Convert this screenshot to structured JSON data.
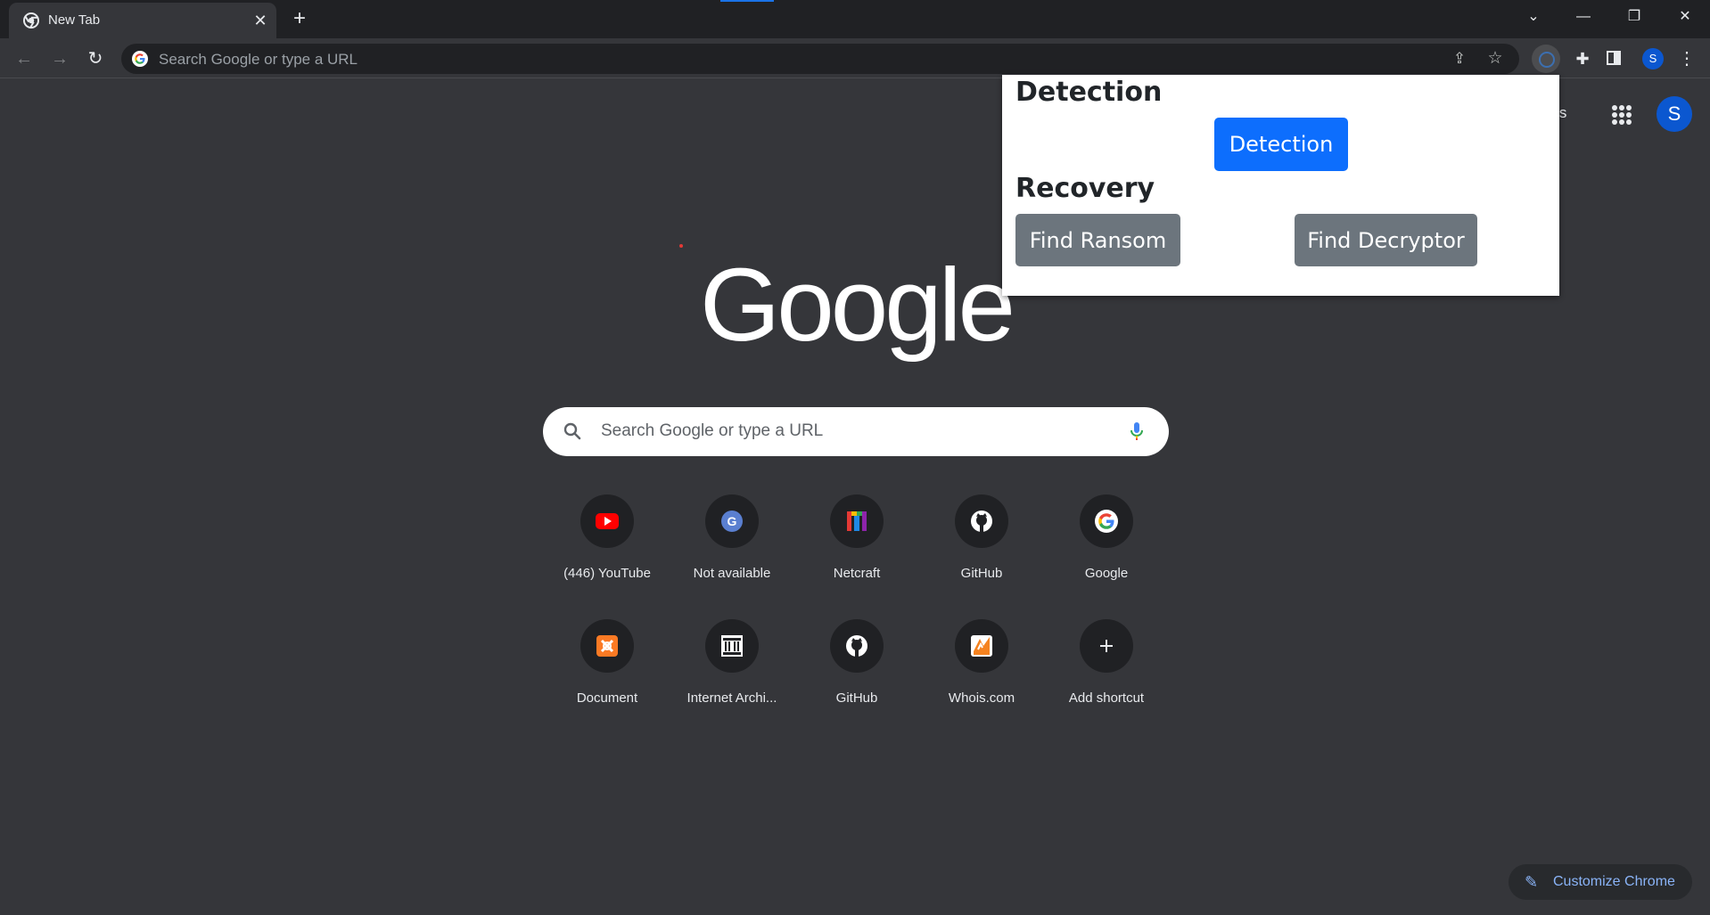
{
  "browser": {
    "tab": {
      "title": "New Tab"
    },
    "omnibox": {
      "placeholder": "Search Google or type a URL"
    },
    "profile_initial": "S"
  },
  "ntp": {
    "images_link": "ges",
    "logo_text": "Google",
    "search": {
      "placeholder": "Search Google or type a URL"
    },
    "shortcuts": [
      {
        "label": "(446) YouTube",
        "icon": "youtube-icon"
      },
      {
        "label": "Not available",
        "icon": "letter-g-icon"
      },
      {
        "label": "Netcraft",
        "icon": "netcraft-icon"
      },
      {
        "label": "GitHub",
        "icon": "github-icon"
      },
      {
        "label": "Google",
        "icon": "google-icon"
      },
      {
        "label": "Document",
        "icon": "xampp-icon"
      },
      {
        "label": "Internet Archi...",
        "icon": "internet-archive-icon"
      },
      {
        "label": "GitHub",
        "icon": "github-icon"
      },
      {
        "label": "Whois.com",
        "icon": "whois-icon"
      },
      {
        "label": "Add shortcut",
        "icon": "plus-icon"
      }
    ],
    "customize_label": "Customize Chrome",
    "profile_initial": "S"
  },
  "popup": {
    "detection_heading": "Detection",
    "detection_button": "Detection",
    "recovery_heading": "Recovery",
    "find_ransom_button": "Find Ransom",
    "find_decryptor_button": "Find Decryptor"
  },
  "colors": {
    "page_bg": "#35363a",
    "titlebar_bg": "#202124",
    "primary_button": "#0d6efd",
    "secondary_button": "#6c757d",
    "profile": "#0b57d0",
    "link_blue": "#8ab4f8"
  }
}
